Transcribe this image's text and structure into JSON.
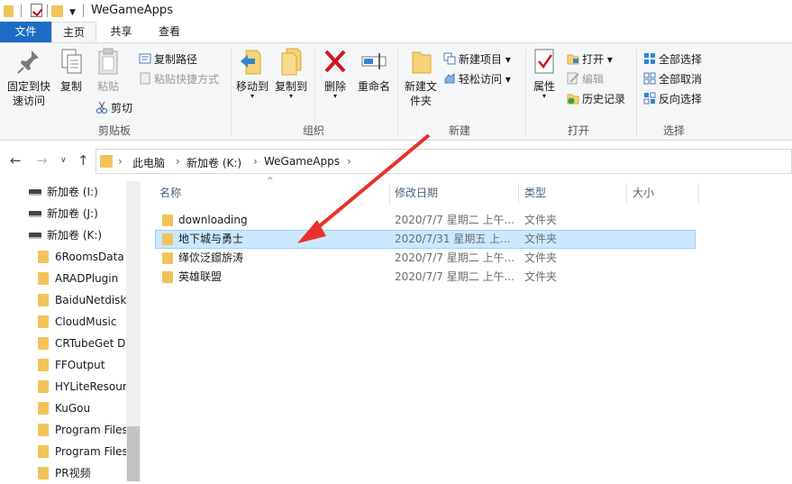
{
  "window": {
    "title": "WeGameApps"
  },
  "tabs": [
    {
      "label": "文件"
    },
    {
      "label": "主页"
    },
    {
      "label": "共享"
    },
    {
      "label": "查看"
    }
  ],
  "ribbon": {
    "clipboard": {
      "label": "剪贴板",
      "pin": "固定到快速访问",
      "copy": "复制",
      "paste": "粘贴",
      "copy_path": "复制路径",
      "paste_shortcut": "粘贴快捷方式",
      "cut": "剪切"
    },
    "organize": {
      "label": "组织",
      "move_to": "移动到",
      "copy_to": "复制到",
      "delete": "删除",
      "rename": "重命名"
    },
    "new": {
      "label": "新建",
      "new_folder": "新建文件夹",
      "new_item": "新建项目",
      "easy_access": "轻松访问"
    },
    "open": {
      "label": "打开",
      "properties": "属性",
      "open": "打开",
      "edit": "编辑",
      "history": "历史记录"
    },
    "select": {
      "label": "选择",
      "select_all": "全部选择",
      "select_none": "全部取消",
      "invert": "反向选择"
    }
  },
  "address": {
    "crumbs": [
      "此电脑",
      "新加卷 (K:)",
      "WeGameApps"
    ]
  },
  "tree": [
    {
      "label": "新加卷 (I:)",
      "type": "drive"
    },
    {
      "label": "新加卷 (J:)",
      "type": "drive"
    },
    {
      "label": "新加卷 (K:)",
      "type": "drive"
    },
    {
      "label": "6RoomsData",
      "type": "folder"
    },
    {
      "label": "ARADPlugin",
      "type": "folder"
    },
    {
      "label": "BaiduNetdisk",
      "type": "folder"
    },
    {
      "label": "CloudMusic",
      "type": "folder"
    },
    {
      "label": "CRTubeGet D",
      "type": "folder"
    },
    {
      "label": "FFOutput",
      "type": "folder"
    },
    {
      "label": "HYLiteResour",
      "type": "folder"
    },
    {
      "label": "KuGou",
      "type": "folder"
    },
    {
      "label": "Program Files",
      "type": "folder"
    },
    {
      "label": "Program Files",
      "type": "folder"
    },
    {
      "label": "PR视频",
      "type": "folder"
    }
  ],
  "columns": {
    "name": "名称",
    "modified": "修改日期",
    "type": "类型",
    "size": "大小"
  },
  "files": [
    {
      "name": "downloading",
      "modified": "2020/7/7 星期二 上午...",
      "type": "文件夹"
    },
    {
      "name": "地下城与勇士",
      "modified": "2020/7/31 星期五 上...",
      "type": "文件夹",
      "selected": true
    },
    {
      "name": "缂佽泛鐛旂涛",
      "modified": "2020/7/7 星期二 上午...",
      "type": "文件夹"
    },
    {
      "name": "英雄联盟",
      "modified": "2020/7/7 星期二 上午...",
      "type": "文件夹"
    }
  ],
  "colors": {
    "accent": "#1c6bc4",
    "selection": "#cce8ff",
    "folder": "#f2c35a",
    "arrow": "#e8312a"
  }
}
